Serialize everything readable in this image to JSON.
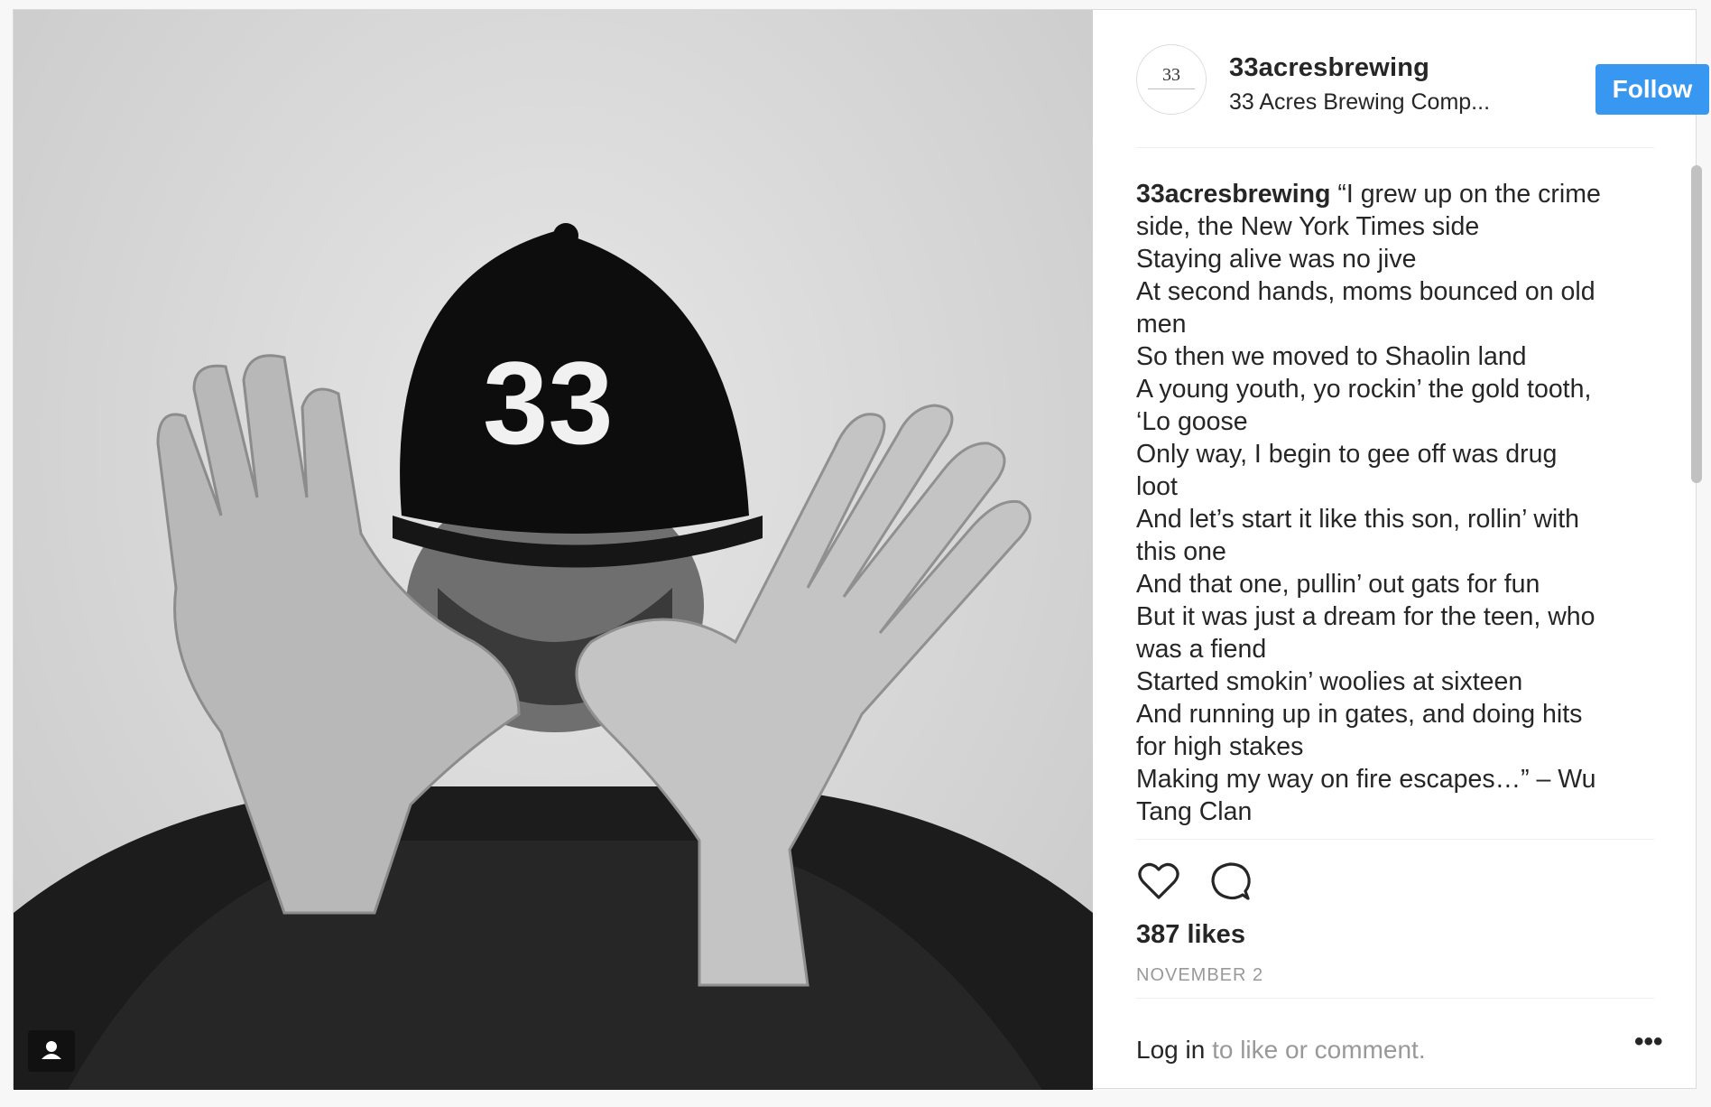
{
  "post": {
    "username": "33acresbrewing",
    "full_name": "33 Acres Brewing Comp...",
    "follow_label": "Follow",
    "avatar_text": "33",
    "caption_user": "33acresbrewing",
    "caption_lines": [
      "“I grew up on the crime",
      "side, the New York Times side",
      "Staying alive was no jive",
      "At second hands, moms bounced on old",
      "men",
      "So then we moved to Shaolin land",
      "A young youth, yo rockin’ the gold tooth,",
      "‘Lo goose",
      "Only way, I begin to gee off was drug",
      "loot",
      "And let’s start it like this son, rollin’ with",
      "this one",
      "And that one, pullin’ out gats for fun",
      "But it was just a dream for the teen, who",
      "was a fiend",
      "Started smokin’ woolies at sixteen",
      "And running up in gates, and doing hits",
      "for high stakes",
      "Making my way on fire escapes…” – Wu",
      "Tang Clan"
    ],
    "likes": "387 likes",
    "date": "NOVEMBER 2",
    "login_link": "Log in",
    "login_rest": " to like or comment.",
    "more_label": "•••",
    "photo_cap_text": "33"
  },
  "icons": {
    "like": "heart-icon",
    "comment": "comment-icon",
    "tag": "user-tag-icon",
    "more": "more-options-icon"
  },
  "colors": {
    "accent": "#3897f0",
    "text": "#262626",
    "muted": "#999999"
  }
}
